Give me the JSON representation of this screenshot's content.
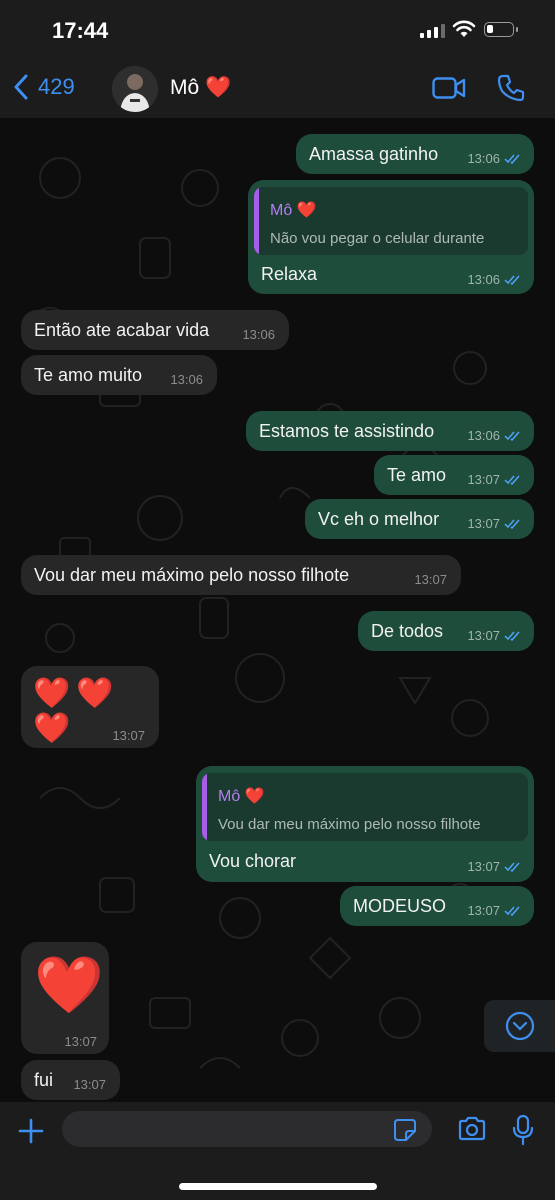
{
  "status": {
    "time": "17:44"
  },
  "header": {
    "back_count": "429",
    "contact_name": "Mô",
    "contact_emoji": "❤️"
  },
  "messages": [
    {
      "dir": "out",
      "text": "Amassa gatinho",
      "time": "13:06"
    },
    {
      "dir": "out",
      "text": "Relaxa",
      "time": "13:06",
      "reply": {
        "name": "Mô ❤️",
        "text": "Não vou pegar o celular durante"
      }
    },
    {
      "dir": "in",
      "text": "Então ate acabar vida",
      "time": "13:06"
    },
    {
      "dir": "in",
      "text": "Te amo muito",
      "time": "13:06"
    },
    {
      "dir": "out",
      "text": "Estamos te assistindo",
      "time": "13:06"
    },
    {
      "dir": "out",
      "text": "Te amo",
      "time": "13:07"
    },
    {
      "dir": "out",
      "text": "Vc eh o melhor",
      "time": "13:07"
    },
    {
      "dir": "in",
      "text": "Vou dar meu máximo pelo nosso filhote",
      "time": "13:07"
    },
    {
      "dir": "out",
      "text": "De todos",
      "time": "13:07"
    },
    {
      "dir": "in",
      "text": "❤️❤️❤️",
      "time": "13:07"
    },
    {
      "dir": "out",
      "text": "Vou chorar",
      "time": "13:07",
      "reply": {
        "name": "Mô ❤️",
        "text": "Vou dar meu máximo pelo nosso filhote"
      }
    },
    {
      "dir": "out",
      "text": "MODEUSO",
      "time": "13:07"
    },
    {
      "dir": "in",
      "text": "❤️",
      "time": "13:07"
    },
    {
      "dir": "in",
      "text": "fui",
      "time": "13:07"
    }
  ],
  "composer": {
    "placeholder": ""
  },
  "colors": {
    "accent": "#3e8ff0",
    "outgoing": "#1e4d3c",
    "incoming": "#272727",
    "quote_name": "#b47ef0"
  }
}
